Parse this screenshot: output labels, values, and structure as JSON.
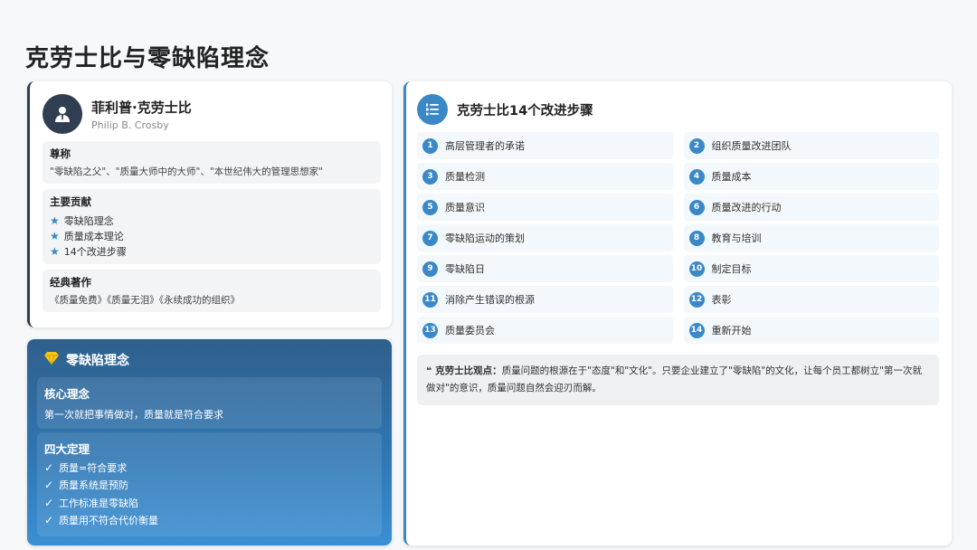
{
  "page": {
    "title": "克劳士比与零缺陷理念"
  },
  "profile": {
    "name": "菲利普·克劳士比",
    "name_en": "Philip B. Crosby",
    "titles_heading": "尊称",
    "titles_text": "\"零缺陷之父\"、\"质量大师中的大师\"、\"本世纪伟大的管理思想家\"",
    "contributions_heading": "主要贡献",
    "contributions": [
      "零缺陷理念",
      "质量成本理论",
      "14个改进步骤"
    ],
    "works_heading": "经典著作",
    "works_text": "《质量免费》《质量无泪》《永续成功的组织》"
  },
  "zero_defect": {
    "title": "零缺陷理念",
    "core_heading": "核心理念",
    "core_text": "第一次就把事情做对，质量就是符合要求",
    "theorems_heading": "四大定理",
    "theorems": [
      "质量=符合要求",
      "质量系统是预防",
      "工作标准是零缺陷",
      "质量用不符合代价衡量"
    ]
  },
  "steps": {
    "title": "克劳士比14个改进步骤",
    "items": [
      {
        "num": "1",
        "label": "高层管理者的承诺"
      },
      {
        "num": "2",
        "label": "组织质量改进团队"
      },
      {
        "num": "3",
        "label": "质量检测"
      },
      {
        "num": "4",
        "label": "质量成本"
      },
      {
        "num": "5",
        "label": "质量意识"
      },
      {
        "num": "6",
        "label": "质量改进的行动"
      },
      {
        "num": "7",
        "label": "零缺陷运动的策划"
      },
      {
        "num": "8",
        "label": "教育与培训"
      },
      {
        "num": "9",
        "label": "零缺陷日"
      },
      {
        "num": "10",
        "label": "制定目标"
      },
      {
        "num": "11",
        "label": "消除产生错误的根源"
      },
      {
        "num": "12",
        "label": "表彰"
      },
      {
        "num": "13",
        "label": "质量委员会"
      },
      {
        "num": "14",
        "label": "重新开始"
      }
    ],
    "quote_label": "克劳士比观点：",
    "quote_text": "质量问题的根源在于\"态度\"和\"文化\"。只要企业建立了\"零缺陷\"的文化，让每个员工都树立\"第一次就做对\"的意识，质量问题自然会迎刃而解。"
  },
  "colors": {
    "accent": "#3a88c8",
    "dark": "#2f3e50",
    "gem": "#f5c518"
  },
  "icons": {
    "avatar": "user-tie-icon",
    "star": "star-icon",
    "gem": "gem-icon",
    "check": "check-icon",
    "list": "list-ol-icon",
    "quote": "quote-left-icon"
  }
}
